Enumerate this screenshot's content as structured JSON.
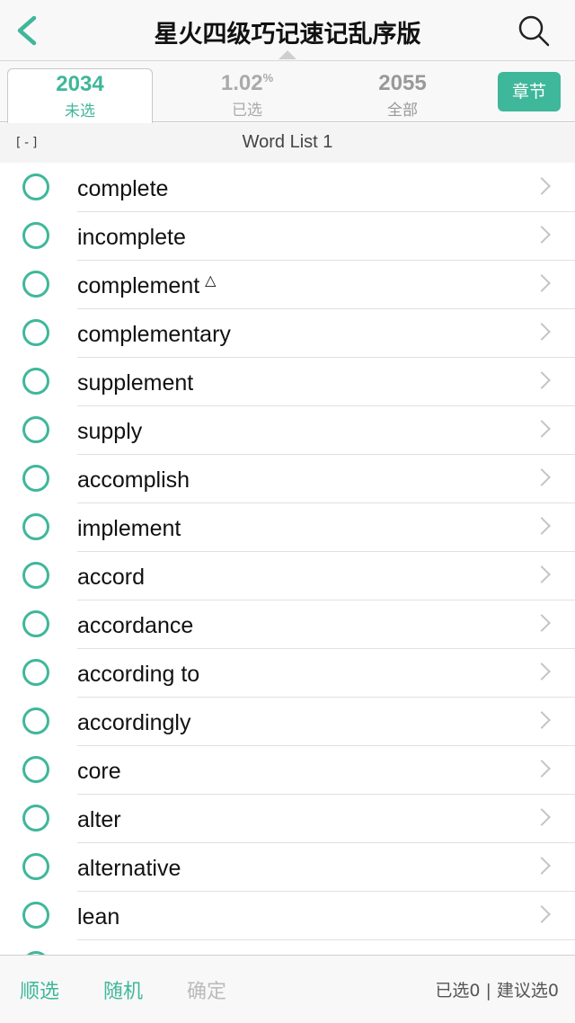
{
  "header": {
    "title": "星火四级巧记速记乱序版",
    "back_icon": "chevron-left-icon",
    "search_icon": "search-icon",
    "accent": "#3fb79a"
  },
  "stats": {
    "unselected": {
      "value": "2034",
      "label": "未选"
    },
    "selected": {
      "value": "1.02",
      "unit": "%",
      "label": "已选"
    },
    "total": {
      "value": "2055",
      "label": "全部"
    },
    "chapter_label": "章节"
  },
  "section": {
    "collapse": "[-]",
    "title": "Word List 1"
  },
  "words": [
    {
      "text": "complete",
      "mark": ""
    },
    {
      "text": "incomplete",
      "mark": ""
    },
    {
      "text": "complement",
      "mark": "△"
    },
    {
      "text": "complementary",
      "mark": ""
    },
    {
      "text": "supplement",
      "mark": ""
    },
    {
      "text": "supply",
      "mark": ""
    },
    {
      "text": "accomplish",
      "mark": ""
    },
    {
      "text": "implement",
      "mark": ""
    },
    {
      "text": "accord",
      "mark": ""
    },
    {
      "text": "accordance",
      "mark": ""
    },
    {
      "text": "according to",
      "mark": ""
    },
    {
      "text": "accordingly",
      "mark": ""
    },
    {
      "text": "core",
      "mark": ""
    },
    {
      "text": "alter",
      "mark": ""
    },
    {
      "text": "alternative",
      "mark": ""
    },
    {
      "text": "lean",
      "mark": ""
    }
  ],
  "footer": {
    "sequential": "顺选",
    "random": "随机",
    "confirm": "确定",
    "status": "已选0 | 建议选0"
  }
}
